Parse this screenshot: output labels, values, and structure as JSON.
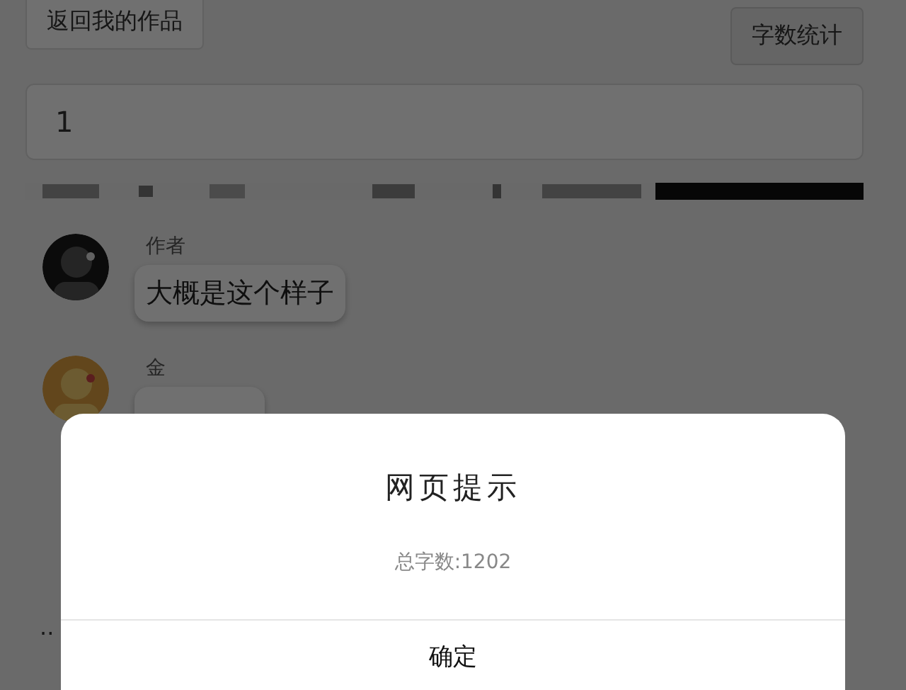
{
  "toolbar": {
    "back_button": "返回我的作品",
    "count_button": "字数统计"
  },
  "title_field": {
    "value": "1"
  },
  "messages": [
    {
      "author": "作者",
      "text": "大概是这个样子"
    },
    {
      "author": "金"
    }
  ],
  "trailing_text": "..",
  "dialog": {
    "title": "网页提示",
    "message": "总字数:1202",
    "buttons": [
      "确定"
    ]
  }
}
